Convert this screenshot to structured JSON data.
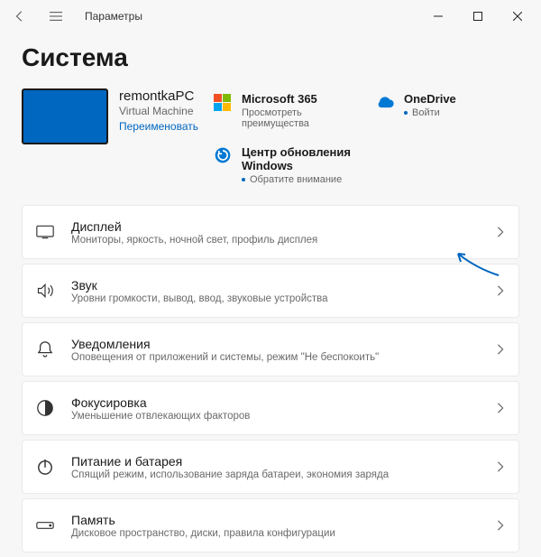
{
  "titlebar": {
    "app_name": "Параметры"
  },
  "heading": "Система",
  "device": {
    "name": "remontkaPC",
    "type": "Virtual Machine",
    "rename": "Переименовать"
  },
  "tiles": {
    "ms365": {
      "title": "Microsoft 365",
      "sub": "Просмотреть преимущества"
    },
    "onedrive": {
      "title": "OneDrive",
      "action": "Войти"
    },
    "update": {
      "title": "Центр обновления Windows",
      "action": "Обратите внимание"
    }
  },
  "rows": [
    {
      "title": "Дисплей",
      "sub": "Мониторы, яркость, ночной свет, профиль дисплея"
    },
    {
      "title": "Звук",
      "sub": "Уровни громкости, вывод, ввод, звуковые устройства"
    },
    {
      "title": "Уведомления",
      "sub": "Оповещения от приложений и системы, режим \"Не беспокоить\""
    },
    {
      "title": "Фокусировка",
      "sub": "Уменьшение отвлекающих факторов"
    },
    {
      "title": "Питание и батарея",
      "sub": "Спящий режим, использование заряда батареи, экономия заряда"
    },
    {
      "title": "Память",
      "sub": "Дисковое пространство, диски, правила конфигурации"
    }
  ]
}
